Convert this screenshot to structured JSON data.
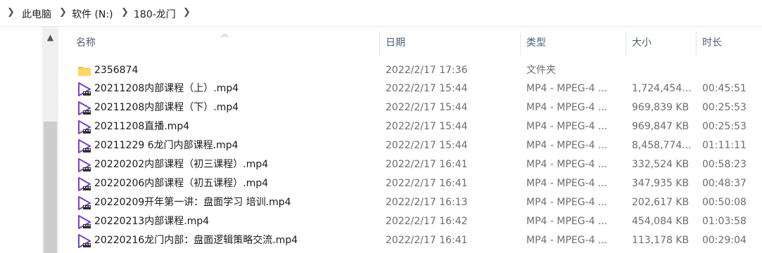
{
  "breadcrumb": {
    "items": [
      "此电脑",
      "软件 (N:)",
      "180-龙门"
    ]
  },
  "columns": {
    "name": "名称",
    "date": "日期",
    "type": "类型",
    "size": "大小",
    "duration": "时长"
  },
  "rows": [
    {
      "icon": "folder-icon",
      "name": "2356874",
      "date": "2022/2/17 17:36",
      "type": "文件夹",
      "size": "",
      "duration": ""
    },
    {
      "icon": "video-file-icon",
      "name": "20211208内部课程（上）.mp4",
      "date": "2022/2/17 15:44",
      "type": "MP4 - MPEG-4 ...",
      "size": "1,724,454...",
      "duration": "00:45:51"
    },
    {
      "icon": "video-file-icon",
      "name": "20211208内部课程（下）.mp4",
      "date": "2022/2/17 15:44",
      "type": "MP4 - MPEG-4 ...",
      "size": "969,839 KB",
      "duration": "00:25:53"
    },
    {
      "icon": "video-file-icon",
      "name": "20211208直播.mp4",
      "date": "2022/2/17 15:44",
      "type": "MP4 - MPEG-4 ...",
      "size": "969,847 KB",
      "duration": "00:25:53"
    },
    {
      "icon": "video-file-icon",
      "name": "20211229 6龙门内部课程.mp4",
      "date": "2022/2/17 15:44",
      "type": "MP4 - MPEG-4 ...",
      "size": "8,458,774...",
      "duration": "01:11:11"
    },
    {
      "icon": "video-file-icon",
      "name": "20220202内部课程（初三课程）.mp4",
      "date": "2022/2/17 16:41",
      "type": "MP4 - MPEG-4 ...",
      "size": "332,524 KB",
      "duration": "00:58:23"
    },
    {
      "icon": "video-file-icon",
      "name": "20220206内部课程（初五课程）.mp4",
      "date": "2022/2/17 16:41",
      "type": "MP4 - MPEG-4 ...",
      "size": "347,935 KB",
      "duration": "00:48:37"
    },
    {
      "icon": "video-file-icon",
      "name": "20220209开年第一讲：盘面学习 培训.mp4",
      "date": "2022/2/17 16:13",
      "type": "MP4 - MPEG-4 ...",
      "size": "202,617 KB",
      "duration": "00:50:08"
    },
    {
      "icon": "video-file-icon",
      "name": "20220213内部课程.mp4",
      "date": "2022/2/17 16:42",
      "type": "MP4 - MPEG-4 ...",
      "size": "454,084 KB",
      "duration": "01:03:58"
    },
    {
      "icon": "video-file-icon",
      "name": "20220216龙门内部：盘面逻辑策略交流.mp4",
      "date": "2022/2/17 16:41",
      "type": "MP4 - MPEG-4 ...",
      "size": "113,178 KB",
      "duration": "00:29:04"
    }
  ],
  "colors": {
    "header_text": "#4c607a",
    "folder_yellow": "#f5c54a",
    "video_purple": "#7b3fc8"
  }
}
